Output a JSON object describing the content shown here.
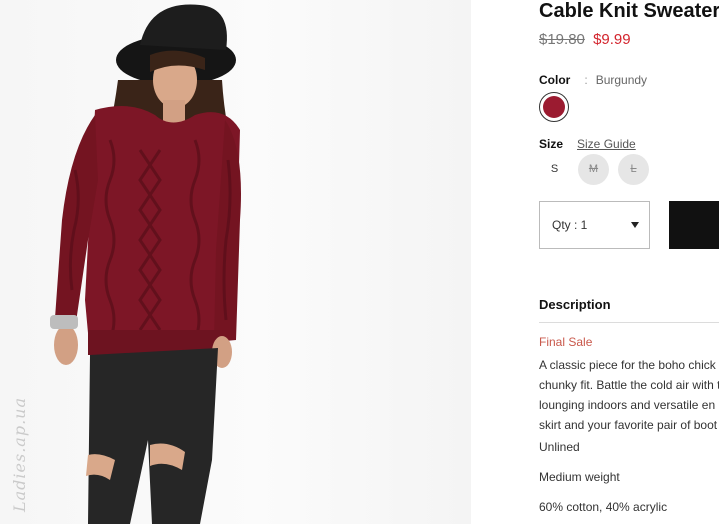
{
  "product": {
    "title": "Cable Knit Sweater",
    "old_price": "$19.80",
    "new_price": "$9.99"
  },
  "color": {
    "label": "Color",
    "separator": ":",
    "value": "Burgundy",
    "swatch_hex": "#9b1b30"
  },
  "size": {
    "label": "Size",
    "guide_link": "Size Guide",
    "options": [
      {
        "label": "S",
        "available": true
      },
      {
        "label": "M",
        "available": false
      },
      {
        "label": "L",
        "available": false
      }
    ]
  },
  "quantity": {
    "label": "Qty : 1"
  },
  "description": {
    "heading": "Description",
    "final_sale": "Final Sale",
    "body_lines": [
      "A classic piece for the boho chick",
      "chunky fit. Battle the cold air with t",
      "lounging indoors and versatile en",
      "skirt and your favorite pair of boot"
    ],
    "specs": [
      "Unlined",
      "Medium weight",
      "60% cotton, 40% acrylic"
    ]
  },
  "watermark": "Ladies.ap.ua",
  "colors": {
    "accent_red": "#d3242d",
    "final_sale": "#c9584b",
    "button": "#111111",
    "sweater": "#7d1626"
  }
}
